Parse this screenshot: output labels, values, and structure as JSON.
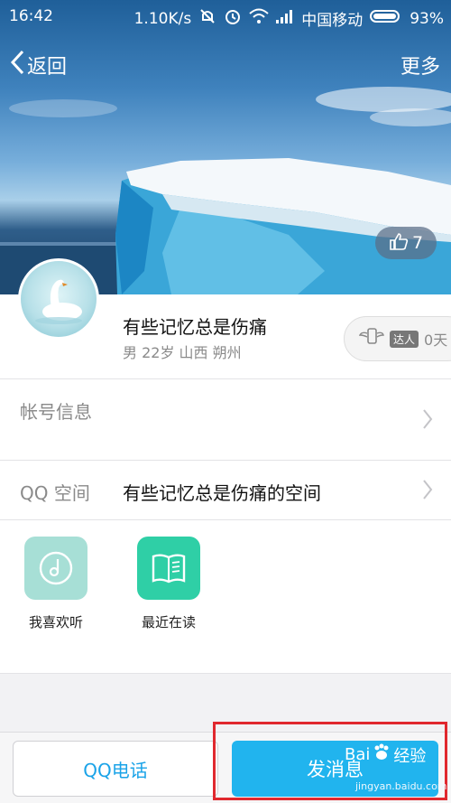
{
  "status_bar": {
    "time": "16:42",
    "network_speed": "1.10K/s",
    "carrier": "中国移动",
    "battery": "93%"
  },
  "nav": {
    "back_label": "返回",
    "more_label": "更多"
  },
  "likes": {
    "count": "7"
  },
  "profile": {
    "name": "有些记忆总是伤痛",
    "meta": "男 22岁 山西 朔州",
    "talent_badge": "达人",
    "talent_days": "0天"
  },
  "rows": {
    "account_label": "帐号信息",
    "qzone_label": "QQ 空间",
    "qzone_value": "有些记忆总是伤痛的空间"
  },
  "apps": [
    {
      "label": "我喜欢听",
      "icon": "music-disc-icon",
      "color": "#a7dfd6"
    },
    {
      "label": "最近在读",
      "icon": "book-icon",
      "color": "#2fcfa6"
    }
  ],
  "bottom": {
    "call_label": "QQ电话",
    "message_label": "发消息"
  },
  "watermark": {
    "brand": "Bai",
    "brand_suffix": "经验",
    "url": "jingyan.baidu.com"
  },
  "colors": {
    "accent": "#21b4ee",
    "highlight": "#e0282e"
  }
}
